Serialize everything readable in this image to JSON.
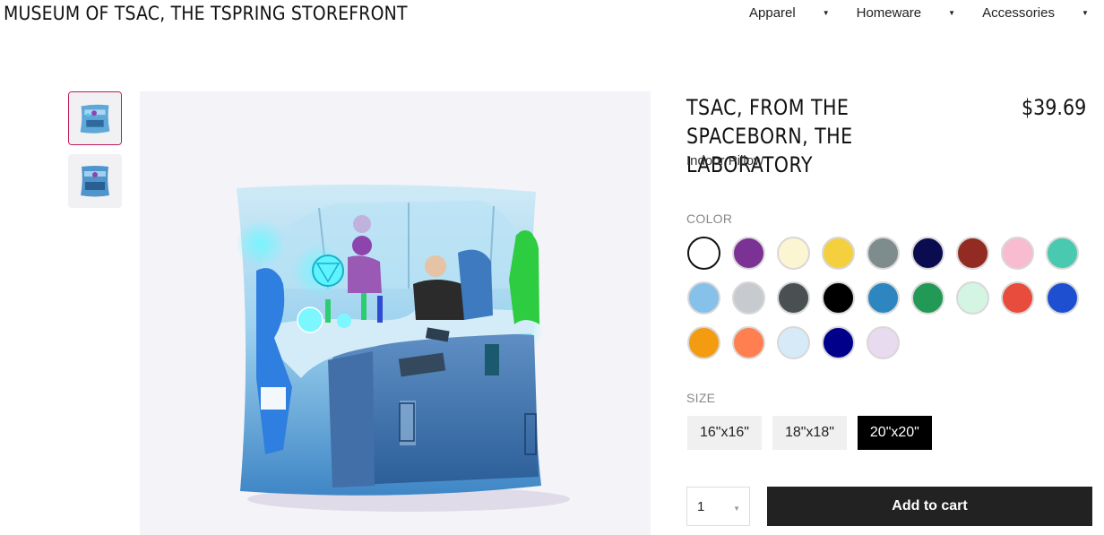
{
  "header": {
    "store_title": "MUSEUM OF TSAC, THE TSPRING STOREFRONT",
    "nav": [
      {
        "label": "Apparel",
        "icon": "caret-down-icon"
      },
      {
        "label": "Homeware",
        "icon": "caret-down-icon"
      },
      {
        "label": "Accessories",
        "icon": "caret-down-icon"
      }
    ],
    "nav_separator": "|"
  },
  "product": {
    "title": "TSAC, FROM THE SPACEBORN, THE LABORATORY",
    "price": "$39.69",
    "type": "Indoor Pillow"
  },
  "color_section": {
    "label": "COLOR",
    "selected_index": 0,
    "swatches": [
      "#ffffff",
      "#7b3294",
      "#fbf5d2",
      "#f4d03f",
      "#7f8c8d",
      "#0b0b4f",
      "#922b21",
      "#f8bbd0",
      "#48c9b0",
      "#85c1e9",
      "#c7cbcf",
      "#4a4f52",
      "#000000",
      "#2e86c1",
      "#229954",
      "#d5f5e3",
      "#e74c3c",
      "#1f4fd1",
      "#f39c12",
      "#ff7f50",
      "#d6eaf8",
      "#00008b",
      "#e8daef"
    ]
  },
  "size_section": {
    "label": "SIZE",
    "options": [
      "16\"x16\"",
      "18\"x18\"",
      "20\"x20\""
    ],
    "selected_index": 2
  },
  "purchase": {
    "quantity": "1",
    "add_to_cart_label": "Add to cart"
  },
  "accent_color": "#c2185b"
}
